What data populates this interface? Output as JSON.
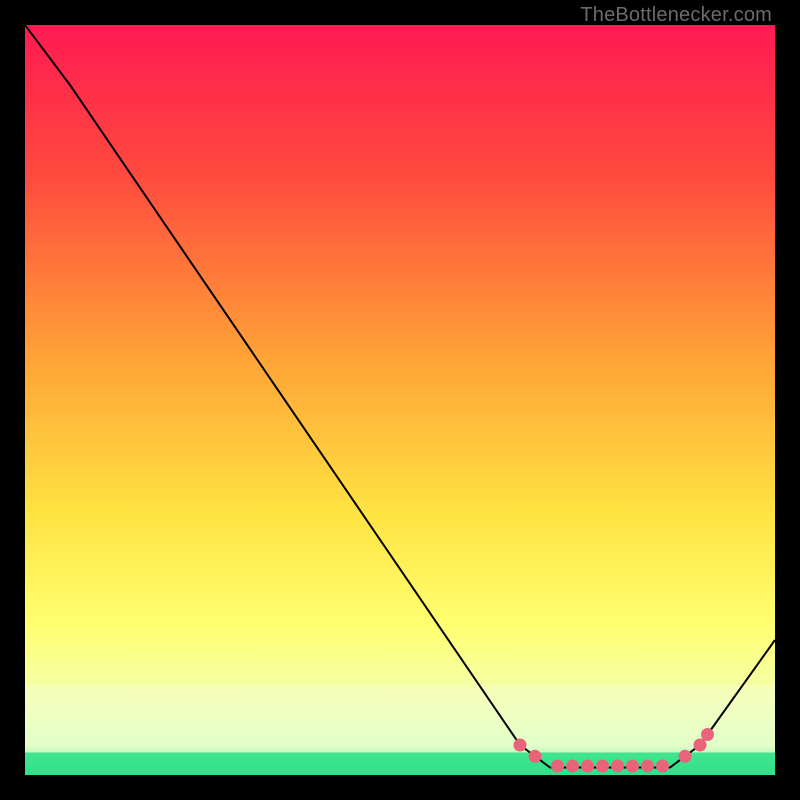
{
  "watermark": "TheBottlenecker.com",
  "chart_data": {
    "type": "line",
    "title": "",
    "xlabel": "",
    "ylabel": "",
    "xlim": [
      0,
      100
    ],
    "ylim": [
      0,
      100
    ],
    "curve": [
      {
        "x": 0,
        "y": 100
      },
      {
        "x": 6,
        "y": 92
      },
      {
        "x": 66,
        "y": 4
      },
      {
        "x": 70,
        "y": 1
      },
      {
        "x": 86,
        "y": 1
      },
      {
        "x": 90,
        "y": 4
      },
      {
        "x": 100,
        "y": 18
      }
    ],
    "markers_x": [
      66,
      68,
      71,
      73,
      75,
      77,
      79,
      81,
      83,
      85,
      88,
      90,
      91
    ],
    "marker_y_at_flat": 1.2,
    "green_band": {
      "from": 0,
      "to": 3
    },
    "pale_band": {
      "from": 3,
      "to": 12
    },
    "gradient_stops": [
      {
        "pct": 0,
        "color": "#ff1a52"
      },
      {
        "pct": 20,
        "color": "#ff4a3e"
      },
      {
        "pct": 45,
        "color": "#ffa537"
      },
      {
        "pct": 65,
        "color": "#ffe342"
      },
      {
        "pct": 80,
        "color": "#ffff70"
      },
      {
        "pct": 90,
        "color": "#f3ffb0"
      },
      {
        "pct": 96,
        "color": "#d8ffc0"
      },
      {
        "pct": 100,
        "color": "#35e08a"
      }
    ]
  }
}
